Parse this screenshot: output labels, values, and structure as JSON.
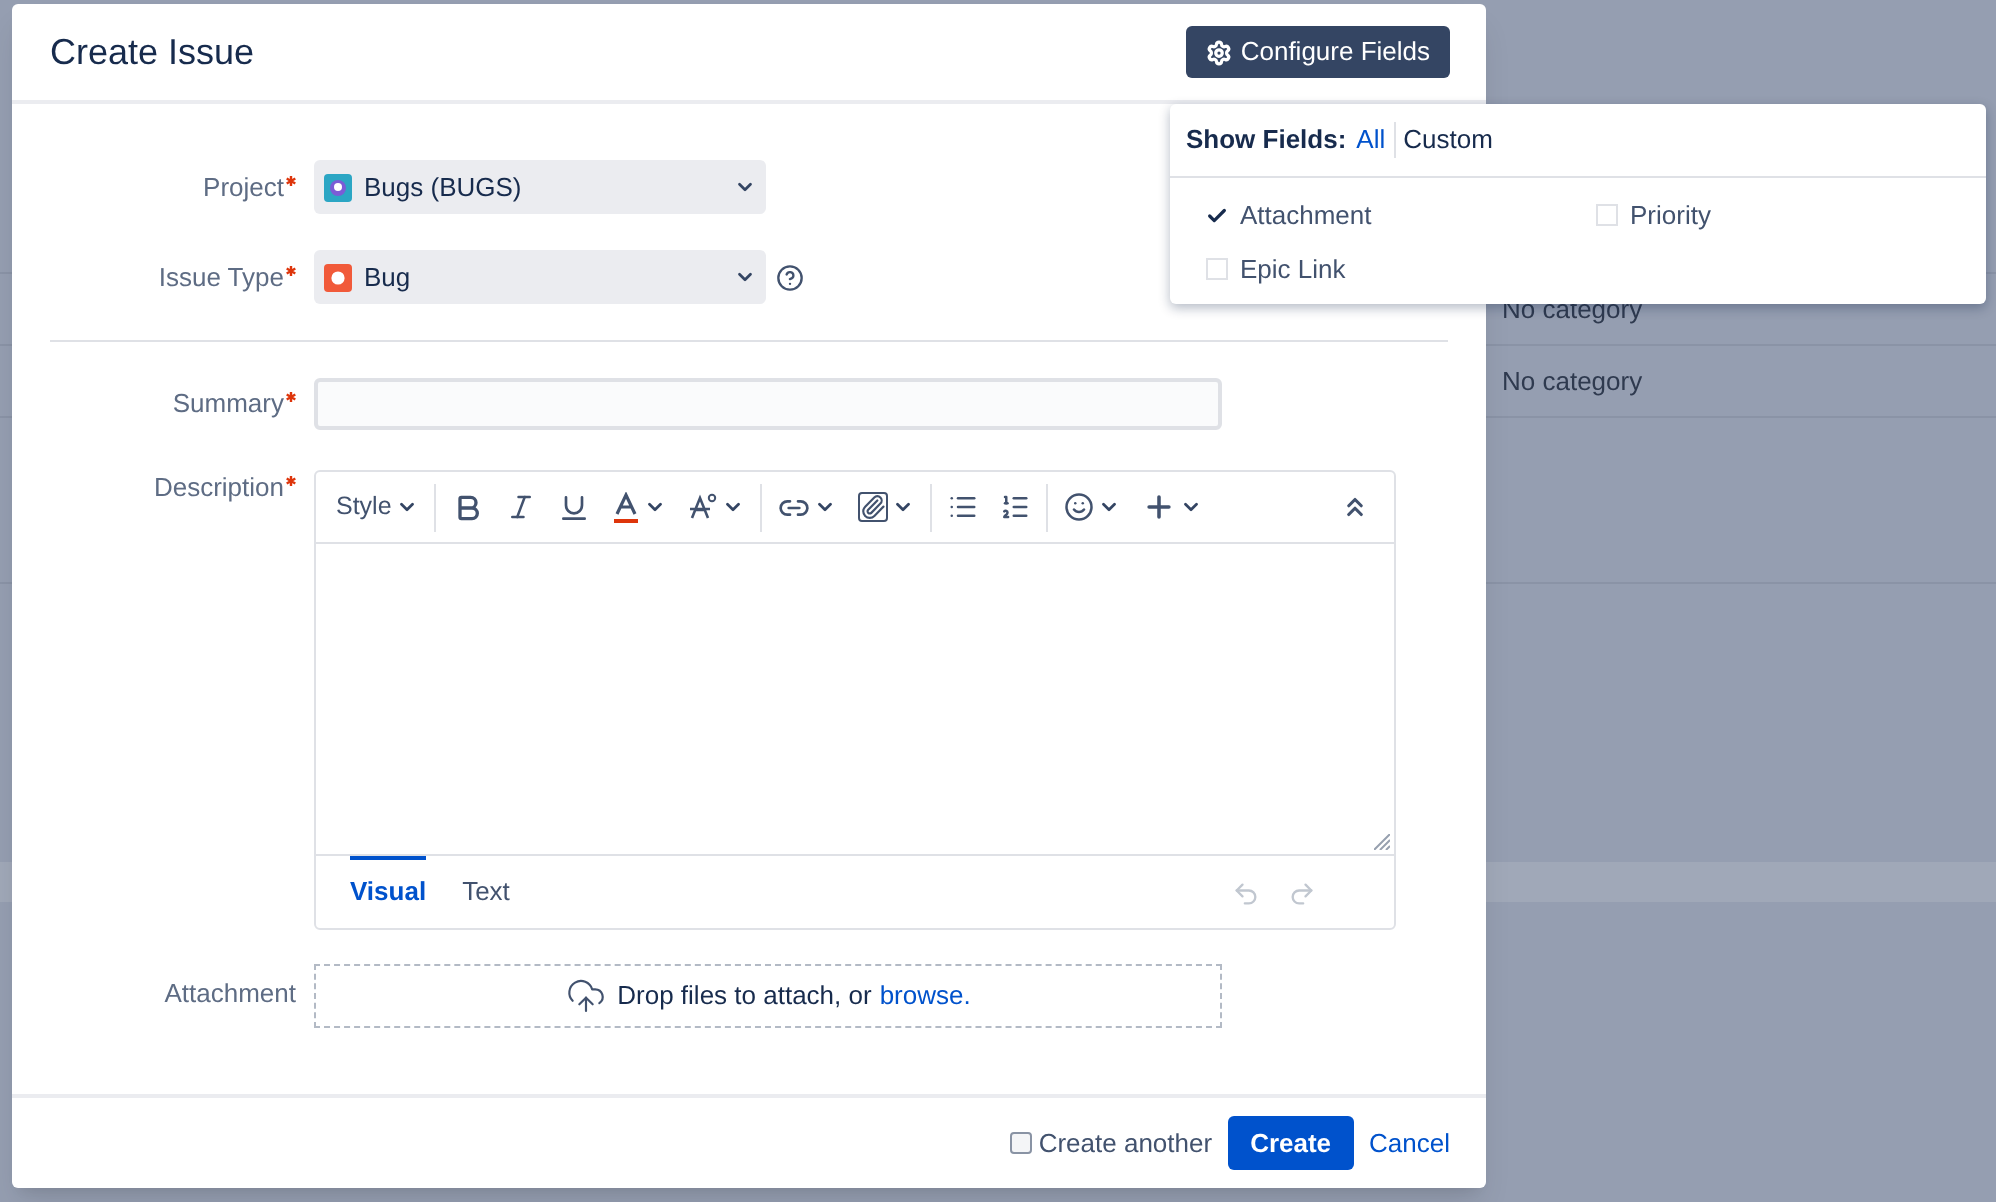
{
  "background": {
    "rows": [
      {
        "category": "No category"
      },
      {
        "category": "No category"
      }
    ]
  },
  "dialog": {
    "title": "Create Issue",
    "configure_button": "Configure Fields"
  },
  "configure_popup": {
    "label": "Show Fields:",
    "modes": [
      {
        "label": "All",
        "selected": true
      },
      {
        "label": "Custom",
        "selected": false
      }
    ],
    "fields": [
      {
        "label": "Attachment",
        "checked": true
      },
      {
        "label": "Priority",
        "checked": false
      },
      {
        "label": "Epic Link",
        "checked": false
      }
    ]
  },
  "form": {
    "project": {
      "label": "Project",
      "required": true,
      "value": "Bugs (BUGS)"
    },
    "issue_type": {
      "label": "Issue Type",
      "required": true,
      "value": "Bug"
    },
    "summary": {
      "label": "Summary",
      "required": true
    },
    "description": {
      "label": "Description",
      "required": true,
      "style_menu": "Style",
      "tabs": [
        {
          "label": "Visual",
          "selected": true
        },
        {
          "label": "Text",
          "selected": false
        }
      ]
    },
    "attachment": {
      "label": "Attachment",
      "drop_text": "Drop files to attach, or",
      "browse_link": "browse."
    }
  },
  "footer": {
    "create_another": {
      "label": "Create another",
      "checked": false
    },
    "create_button": "Create",
    "cancel_link": "Cancel"
  }
}
